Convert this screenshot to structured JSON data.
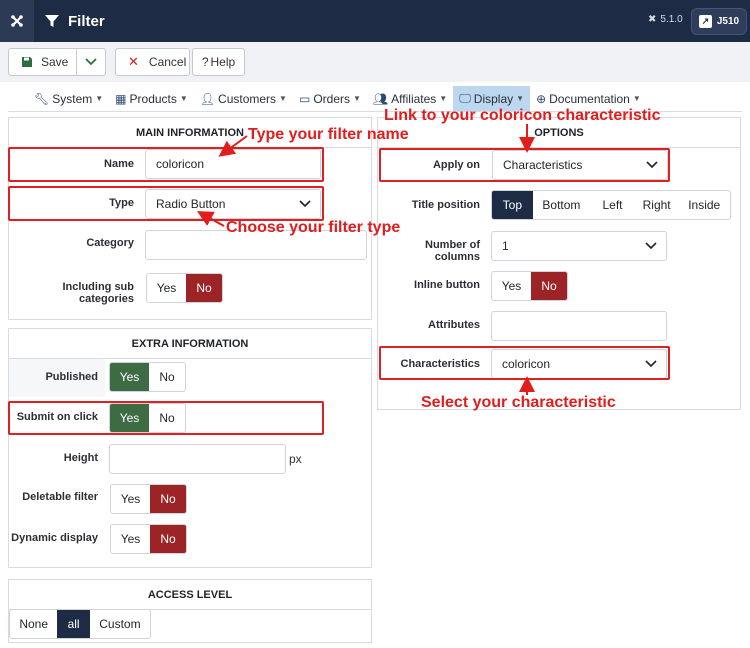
{
  "header": {
    "title": "Filter",
    "version": "5.1.0",
    "site_label": "J510"
  },
  "toolbar": {
    "save_label": "Save",
    "cancel_label": "Cancel",
    "help_label": "Help"
  },
  "menu": {
    "items": [
      {
        "label": "System",
        "icon": "wrench-icon"
      },
      {
        "label": "Products",
        "icon": "cubes-icon"
      },
      {
        "label": "Customers",
        "icon": "user-icon"
      },
      {
        "label": "Orders",
        "icon": "credit-card-icon"
      },
      {
        "label": "Affiliates",
        "icon": "users-icon"
      },
      {
        "label": "Display",
        "icon": "monitor-icon",
        "active": true
      },
      {
        "label": "Documentation",
        "icon": "lifebuoy-icon"
      }
    ]
  },
  "main_info": {
    "heading": "MAIN INFORMATION",
    "name_label": "Name",
    "name_value": "coloricon",
    "type_label": "Type",
    "type_value": "Radio Button",
    "category_label": "Category",
    "category_value": "",
    "subcat_label": "Including sub categories",
    "subcat_yes": "Yes",
    "subcat_no": "No",
    "subcat_selected": "No"
  },
  "extra_info": {
    "heading": "EXTRA INFORMATION",
    "published_label": "Published",
    "published_yes": "Yes",
    "published_no": "No",
    "published_selected": "Yes",
    "submit_label": "Submit on click",
    "submit_yes": "Yes",
    "submit_no": "No",
    "submit_selected": "Yes",
    "height_label": "Height",
    "height_value": "",
    "height_unit": "px",
    "deletable_label": "Deletable filter",
    "deletable_yes": "Yes",
    "deletable_no": "No",
    "deletable_selected": "No",
    "dynamic_label": "Dynamic display",
    "dynamic_yes": "Yes",
    "dynamic_no": "No",
    "dynamic_selected": "No"
  },
  "access": {
    "heading": "ACCESS LEVEL",
    "none": "None",
    "all": "all",
    "custom": "Custom",
    "selected": "all"
  },
  "options": {
    "heading": "OPTIONS",
    "apply_label": "Apply on",
    "apply_value": "Characteristics",
    "title_pos_label": "Title position",
    "title_pos_options": [
      "Top",
      "Bottom",
      "Left",
      "Right",
      "Inside"
    ],
    "title_pos_selected": "Top",
    "columns_label": "Number of columns",
    "columns_value": "1",
    "inline_label": "Inline button",
    "inline_yes": "Yes",
    "inline_no": "No",
    "inline_selected": "No",
    "attributes_label": "Attributes",
    "attributes_value": "",
    "characteristics_label": "Characteristics",
    "characteristics_value": "coloricon"
  },
  "annotations": {
    "filter_name": "Type your filter name",
    "filter_type": "Choose your filter type",
    "link": "Link to your coloricon characteristic",
    "select": "Select your characteristic"
  },
  "colors": {
    "header_bg": "#1e2b45",
    "active_green": "#3d6b44",
    "active_red": "#9c2426",
    "annotation_red": "#e11d1d"
  }
}
